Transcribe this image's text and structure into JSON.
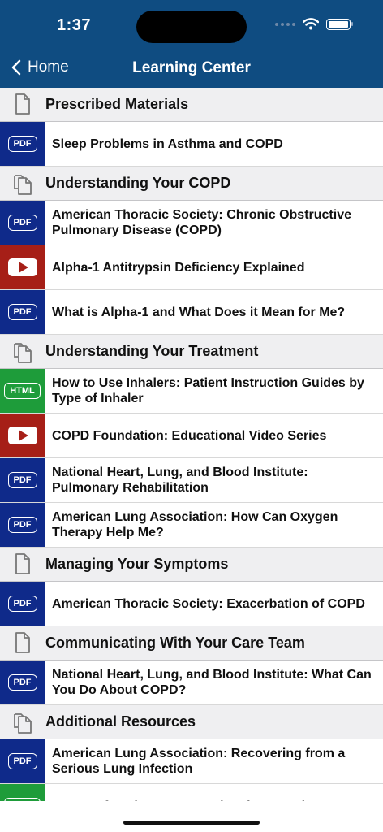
{
  "status": {
    "time": "1:37"
  },
  "nav": {
    "back_label": "Home",
    "title": "Learning Center"
  },
  "sections": [
    {
      "title": "Prescribed Materials",
      "icon": "document-icon",
      "items": [
        {
          "type": "PDF",
          "title": "Sleep Problems in Asthma and COPD"
        }
      ]
    },
    {
      "title": "Understanding Your COPD",
      "icon": "documents-icon",
      "items": [
        {
          "type": "PDF",
          "title": "American Thoracic Society: Chronic Obstructive Pulmonary Disease (COPD)"
        },
        {
          "type": "video",
          "title": "Alpha-1 Antitrypsin Deficiency Explained"
        },
        {
          "type": "PDF",
          "title": "What is Alpha-1 and What Does it Mean for Me?"
        }
      ]
    },
    {
      "title": "Understanding Your Treatment",
      "icon": "documents-icon",
      "items": [
        {
          "type": "HTML",
          "title": "How to Use Inhalers: Patient Instruction Guides by Type of Inhaler"
        },
        {
          "type": "video",
          "title": "COPD Foundation: Educational Video Series"
        },
        {
          "type": "PDF",
          "title": "National Heart, Lung, and Blood Institute: Pulmonary Rehabilitation"
        },
        {
          "type": "PDF",
          "title": "American Lung Association: How Can Oxygen Therapy Help Me?"
        }
      ]
    },
    {
      "title": "Managing Your Symptoms",
      "icon": "document-icon",
      "items": [
        {
          "type": "PDF",
          "title": "American Thoracic Society: Exacerbation of COPD"
        }
      ]
    },
    {
      "title": "Communicating With Your Care Team",
      "icon": "document-icon",
      "items": [
        {
          "type": "PDF",
          "title": "National Heart, Lung, and Blood Institute: What Can You Do About COPD?"
        }
      ]
    },
    {
      "title": "Additional Resources",
      "icon": "documents-icon",
      "items": [
        {
          "type": "PDF",
          "title": "American Lung Association: Recovering from a Serious Lung Infection"
        },
        {
          "type": "HTML",
          "title": "Centers for Disease Control and Prevention:"
        }
      ]
    }
  ],
  "colors": {
    "navbar": "#0f4c81",
    "pdf": "#0f2a8a",
    "video": "#a61f17",
    "html": "#1e9c3a",
    "section_bg": "#efeff1"
  }
}
